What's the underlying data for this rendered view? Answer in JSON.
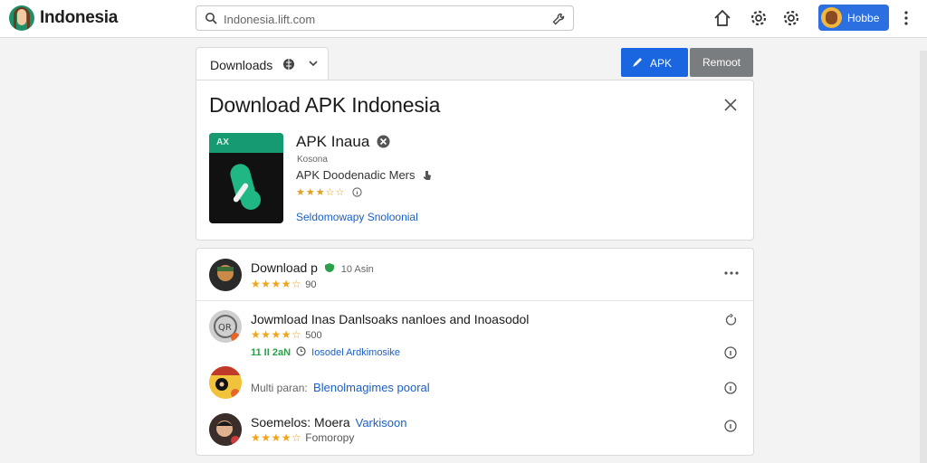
{
  "header": {
    "brand": "Indonesia",
    "search_placeholder": "Indonesia.lift.com",
    "user_label": "Hobbe"
  },
  "toolbar": {
    "downloads_tab": "Downloads",
    "apk_button": "APK",
    "cancel_button": "Remoot"
  },
  "detail": {
    "title": "Download APK Indonesia",
    "icon_band": "AX",
    "app_name": "APK Inaua",
    "app_sub": "Kosona",
    "developer": "APK Doodenadic Mers",
    "rating_stars": "★★★☆☆",
    "link": "Seldomowapy Snoloonial"
  },
  "list": {
    "header": {
      "title": "Download p",
      "meta": "10 Asin",
      "stars": "★★★★☆",
      "count": "90"
    },
    "items": [
      {
        "title": "Jowmload Inas Danlsoaks nanloes and Inoasodol",
        "stars": "★★★★☆",
        "count": "500",
        "meta_prefix": "11 II 2aN",
        "meta_link": "Iosodel Ardkimosike"
      },
      {
        "title": "",
        "meta_prefix": "Multi paran:",
        "meta_link": "Blenolmagimes pooral"
      },
      {
        "title": "Soemelos: Moera",
        "title_link": "Varkisoon",
        "stars": "★★★★☆",
        "meta_link": "Fomoropy"
      }
    ]
  },
  "colors": {
    "accent": "#1a66e0",
    "link": "#1a5fc8",
    "star": "#f2a51a",
    "app_band": "#169a72"
  }
}
